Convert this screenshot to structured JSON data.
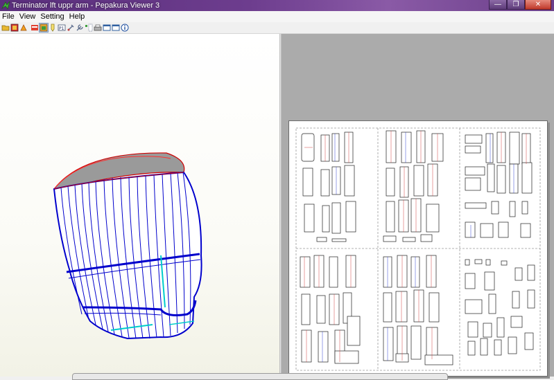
{
  "window": {
    "title": "Terminator lft uppr arm - Pepakura Viewer 3",
    "buttons": {
      "minimize": "—",
      "maximize": "❐",
      "close": "✕"
    }
  },
  "menu": {
    "items": [
      "File",
      "View",
      "Setting",
      "Help"
    ]
  },
  "toolbar": {
    "icons": [
      "open-folder-icon",
      "3d-view-icon",
      "print-icon",
      "unfold-icon",
      "3d-2d-view-icon",
      "highlight-icon",
      "scale-text-icon",
      "settings-icon",
      "tool-icon",
      "piece-icon",
      "printer-icon",
      "window-icon",
      "window-icon",
      "info-icon"
    ],
    "selected": [
      "3d-2d-view-icon"
    ]
  },
  "colors": {
    "titlebar": "#6d3d8e",
    "edge_blue": "#0000cc",
    "edge_red": "#cc0000",
    "fold_cyan": "#00cccc"
  }
}
